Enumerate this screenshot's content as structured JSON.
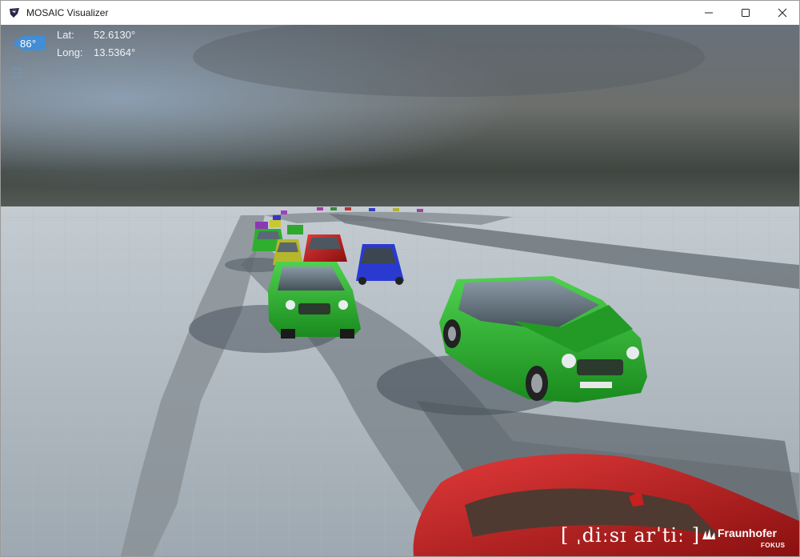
{
  "window": {
    "title": "MOSAIC Visualizer",
    "controls": {
      "minimize": "minimize-icon",
      "maximize": "maximize-icon",
      "close": "close-icon"
    }
  },
  "hud": {
    "heading": "86°",
    "lat_label": "Lat:",
    "lat_value": "52.6130°",
    "long_label": "Long:",
    "long_value": "13.5364°",
    "menu_icon": "hamburger-menu-icon"
  },
  "scene": {
    "vehicles": [
      {
        "color": "green",
        "hex": "#28a828"
      },
      {
        "color": "red",
        "hex": "#c01818"
      },
      {
        "color": "blue",
        "hex": "#2838c8"
      },
      {
        "color": "yellow",
        "hex": "#b8b428"
      },
      {
        "color": "purple",
        "hex": "#8838a8"
      }
    ]
  },
  "logos": {
    "disarti": "[ ˌdiːsɪ arˈtiː ]",
    "fraunhofer": "Fraunhofer",
    "fraunhofer_sub": "FOKUS"
  }
}
